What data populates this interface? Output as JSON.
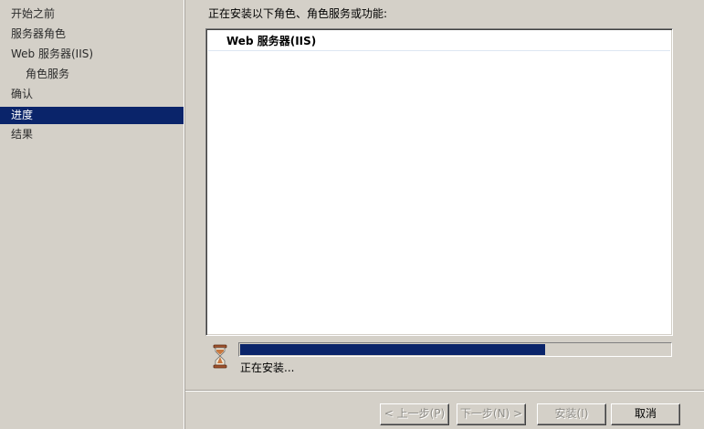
{
  "nav": {
    "items": [
      {
        "label": "开始之前",
        "active": false,
        "sub": false
      },
      {
        "label": "服务器角色",
        "active": false,
        "sub": false
      },
      {
        "label": "Web 服务器(IIS)",
        "active": false,
        "sub": false
      },
      {
        "label": "角色服务",
        "active": false,
        "sub": true
      },
      {
        "label": "确认",
        "active": false,
        "sub": false
      },
      {
        "label": "进度",
        "active": true,
        "sub": false
      },
      {
        "label": "结果",
        "active": false,
        "sub": false
      }
    ]
  },
  "main": {
    "heading": "正在安装以下角色、角色服务或功能:",
    "install_list": [
      "Web 服务器(IIS)"
    ],
    "progress": {
      "fraction": 0.71,
      "status": "正在安装..."
    }
  },
  "buttons": {
    "back": "< 上一步(P)",
    "next": "下一步(N) >",
    "install": "安装(I)",
    "cancel": "取消"
  },
  "colors": {
    "selection": "#0a246a",
    "window_bg": "#d4d0c8"
  },
  "icons": {
    "progress_indicator": "hourglass-icon"
  }
}
